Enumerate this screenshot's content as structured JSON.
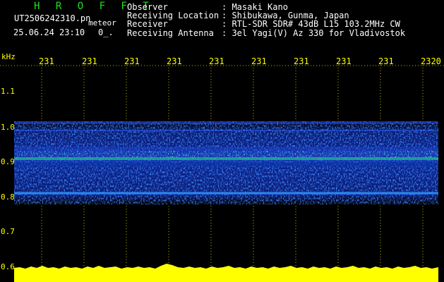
{
  "header": {
    "brand": "H R O F F T",
    "filename": "UT2506242310.pn",
    "tag": "meteor",
    "datetime": "25.06.24 23:10",
    "dots": "0_."
  },
  "info": [
    {
      "key": "Observer",
      "value": ": Masaki Kano"
    },
    {
      "key": "Receiving Location",
      "value": ": Shibukawa, Gunma, Japan"
    },
    {
      "key": "Receiver",
      "value": ": RTL-SDR SDR# 43dB L15 103.2MHz CW"
    },
    {
      "key": "Receiving Antenna",
      "value": ": 3el Yagi(V) Az 330 for Vladivostok"
    }
  ],
  "axis": {
    "unit": "kHz",
    "x_ticks": [
      "231",
      "231",
      "231",
      "231",
      "231",
      "231",
      "231",
      "231",
      "231",
      "2320"
    ],
    "y_ticks": [
      "1.1",
      "1.0",
      "0.9",
      "0.8",
      "0.7",
      "0.6"
    ]
  },
  "colors": {
    "label": "#ffff00",
    "brand": "#22e022",
    "text": "#ffffff",
    "background": "#000000",
    "noise": "#1a3cff",
    "power": "#ffff00"
  }
}
